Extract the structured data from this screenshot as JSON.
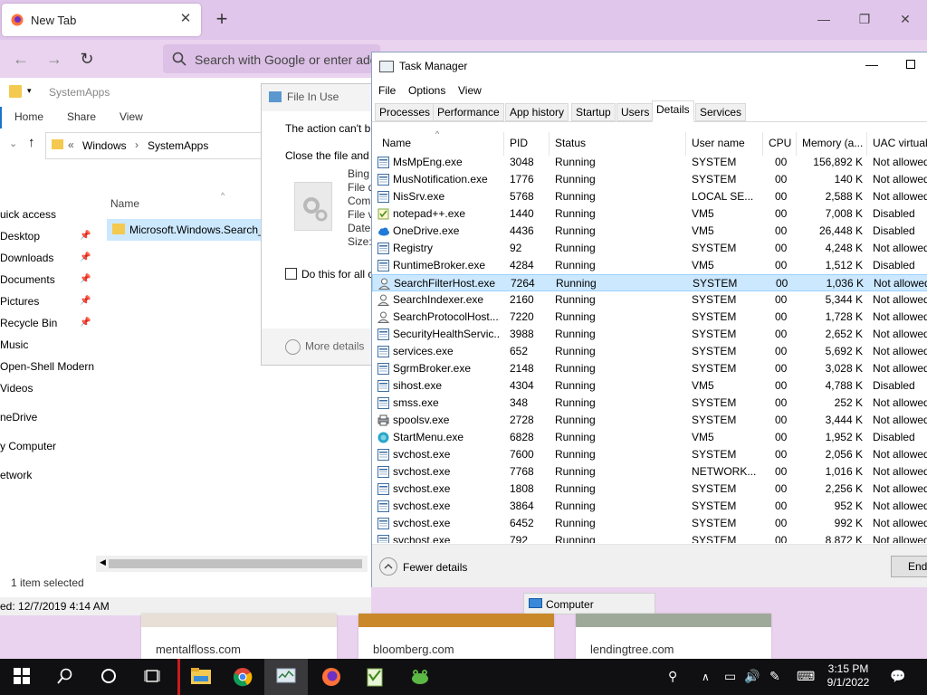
{
  "firefox": {
    "tab_title": "New Tab",
    "search_placeholder": "Search with Google or enter add",
    "icons": {
      "close": "close-icon",
      "new_tab": "plus-icon",
      "back": "arrow-left-icon",
      "forward": "arrow-right-icon",
      "reload": "reload-icon",
      "search": "search-icon"
    }
  },
  "explorer": {
    "title": "SystemApps",
    "ribbon": [
      "Home",
      "Share",
      "View"
    ],
    "breadcrumb": [
      "Windows",
      "SystemApps"
    ],
    "nav_items": [
      {
        "label": "uick access",
        "pinned": false
      },
      {
        "label": "Desktop",
        "pinned": true
      },
      {
        "label": "Downloads",
        "pinned": true
      },
      {
        "label": "Documents",
        "pinned": true
      },
      {
        "label": "Pictures",
        "pinned": true
      },
      {
        "label": "Recycle Bin",
        "pinned": true
      },
      {
        "label": "Music",
        "pinned": false
      },
      {
        "label": "Open-Shell Modern",
        "pinned": false
      },
      {
        "label": "Videos",
        "pinned": false
      },
      {
        "label": "neDrive",
        "pinned": false
      },
      {
        "label": "y Computer",
        "pinned": false
      },
      {
        "label": "etwork",
        "pinned": false
      }
    ],
    "column_name": "Name",
    "item": "Microsoft.Windows.Search_",
    "status": "1 item selected",
    "modified": "ed: 12/7/2019 4:14 AM"
  },
  "file_in_use": {
    "title": "File In Use",
    "msg1": "The action can't b",
    "msg2": "Close the file and",
    "info": [
      "Bing",
      "File d",
      "Com",
      "File v",
      "Date",
      "Size:"
    ],
    "checkbox": "Do this for all c",
    "more": "More details"
  },
  "task_manager": {
    "title": "Task Manager",
    "menu": [
      "File",
      "Options",
      "View"
    ],
    "tabs": [
      "Processes",
      "Performance",
      "App history",
      "Startup",
      "Users",
      "Details",
      "Services"
    ],
    "active_tab": "Details",
    "columns": [
      "Name",
      "PID",
      "Status",
      "User name",
      "CPU",
      "Memory (a...",
      "UAC virtual"
    ],
    "rows": [
      {
        "name": "MsMpEng.exe",
        "pid": "3048",
        "status": "Running",
        "user": "SYSTEM",
        "cpu": "00",
        "mem": "156,892 K",
        "uac": "Not allowed",
        "icon": "app-icon"
      },
      {
        "name": "MusNotification.exe",
        "pid": "1776",
        "status": "Running",
        "user": "SYSTEM",
        "cpu": "00",
        "mem": "140 K",
        "uac": "Not allowed",
        "icon": "app-icon"
      },
      {
        "name": "NisSrv.exe",
        "pid": "5768",
        "status": "Running",
        "user": "LOCAL SE...",
        "cpu": "00",
        "mem": "2,588 K",
        "uac": "Not allowed",
        "icon": "app-icon"
      },
      {
        "name": "notepad++.exe",
        "pid": "1440",
        "status": "Running",
        "user": "VM5",
        "cpu": "00",
        "mem": "7,008 K",
        "uac": "Disabled",
        "icon": "notepad-icon"
      },
      {
        "name": "OneDrive.exe",
        "pid": "4436",
        "status": "Running",
        "user": "VM5",
        "cpu": "00",
        "mem": "26,448 K",
        "uac": "Disabled",
        "icon": "cloud-icon"
      },
      {
        "name": "Registry",
        "pid": "92",
        "status": "Running",
        "user": "SYSTEM",
        "cpu": "00",
        "mem": "4,248 K",
        "uac": "Not allowed",
        "icon": "app-icon"
      },
      {
        "name": "RuntimeBroker.exe",
        "pid": "4284",
        "status": "Running",
        "user": "VM5",
        "cpu": "00",
        "mem": "1,512 K",
        "uac": "Disabled",
        "icon": "app-icon"
      },
      {
        "name": "SearchFilterHost.exe",
        "pid": "7264",
        "status": "Running",
        "user": "SYSTEM",
        "cpu": "00",
        "mem": "1,036 K",
        "uac": "Not allowed",
        "icon": "search-person-icon"
      },
      {
        "name": "SearchIndexer.exe",
        "pid": "2160",
        "status": "Running",
        "user": "SYSTEM",
        "cpu": "00",
        "mem": "5,344 K",
        "uac": "Not allowed",
        "icon": "search-person-icon"
      },
      {
        "name": "SearchProtocolHost....",
        "pid": "7220",
        "status": "Running",
        "user": "SYSTEM",
        "cpu": "00",
        "mem": "1,728 K",
        "uac": "Not allowed",
        "icon": "search-person-icon"
      },
      {
        "name": "SecurityHealthServic...",
        "pid": "3988",
        "status": "Running",
        "user": "SYSTEM",
        "cpu": "00",
        "mem": "2,652 K",
        "uac": "Not allowed",
        "icon": "app-icon"
      },
      {
        "name": "services.exe",
        "pid": "652",
        "status": "Running",
        "user": "SYSTEM",
        "cpu": "00",
        "mem": "5,692 K",
        "uac": "Not allowed",
        "icon": "app-icon"
      },
      {
        "name": "SgrmBroker.exe",
        "pid": "2148",
        "status": "Running",
        "user": "SYSTEM",
        "cpu": "00",
        "mem": "3,028 K",
        "uac": "Not allowed",
        "icon": "app-icon"
      },
      {
        "name": "sihost.exe",
        "pid": "4304",
        "status": "Running",
        "user": "VM5",
        "cpu": "00",
        "mem": "4,788 K",
        "uac": "Disabled",
        "icon": "app-icon"
      },
      {
        "name": "smss.exe",
        "pid": "348",
        "status": "Running",
        "user": "SYSTEM",
        "cpu": "00",
        "mem": "252 K",
        "uac": "Not allowed",
        "icon": "app-icon"
      },
      {
        "name": "spoolsv.exe",
        "pid": "2728",
        "status": "Running",
        "user": "SYSTEM",
        "cpu": "00",
        "mem": "3,444 K",
        "uac": "Not allowed",
        "icon": "printer-icon"
      },
      {
        "name": "StartMenu.exe",
        "pid": "6828",
        "status": "Running",
        "user": "VM5",
        "cpu": "00",
        "mem": "1,952 K",
        "uac": "Disabled",
        "icon": "shell-icon"
      },
      {
        "name": "svchost.exe",
        "pid": "7600",
        "status": "Running",
        "user": "SYSTEM",
        "cpu": "00",
        "mem": "2,056 K",
        "uac": "Not allowed",
        "icon": "app-icon"
      },
      {
        "name": "svchost.exe",
        "pid": "7768",
        "status": "Running",
        "user": "NETWORK...",
        "cpu": "00",
        "mem": "1,016 K",
        "uac": "Not allowed",
        "icon": "app-icon"
      },
      {
        "name": "svchost.exe",
        "pid": "1808",
        "status": "Running",
        "user": "SYSTEM",
        "cpu": "00",
        "mem": "2,256 K",
        "uac": "Not allowed",
        "icon": "app-icon"
      },
      {
        "name": "svchost.exe",
        "pid": "3864",
        "status": "Running",
        "user": "SYSTEM",
        "cpu": "00",
        "mem": "952 K",
        "uac": "Not allowed",
        "icon": "app-icon"
      },
      {
        "name": "svchost.exe",
        "pid": "6452",
        "status": "Running",
        "user": "SYSTEM",
        "cpu": "00",
        "mem": "992 K",
        "uac": "Not allowed",
        "icon": "app-icon"
      },
      {
        "name": "svchost.exe",
        "pid": "792",
        "status": "Running",
        "user": "SYSTEM",
        "cpu": "00",
        "mem": "8,872 K",
        "uac": "Not allowed",
        "icon": "app-icon"
      }
    ],
    "selected_row": "SearchFilterHost.exe",
    "fewer_details": "Fewer details",
    "end_task": "End"
  },
  "computer_label": "Computer",
  "tiles": [
    "mentalfloss.com",
    "bloomberg.com",
    "lendingtree.com"
  ],
  "taskbar": {
    "time": "3:15 PM",
    "date": "9/1/2022",
    "apps": [
      "start-icon",
      "search-icon",
      "cortana-icon",
      "task-view-icon",
      "file-explorer-icon",
      "chrome-icon",
      "task-manager-icon",
      "firefox-icon",
      "notepad-plus-icon",
      "frog-icon"
    ]
  },
  "colors": {
    "firefox_chrome": "#e1c6ec",
    "selection": "#cce8ff",
    "taskbar": "#101012"
  }
}
